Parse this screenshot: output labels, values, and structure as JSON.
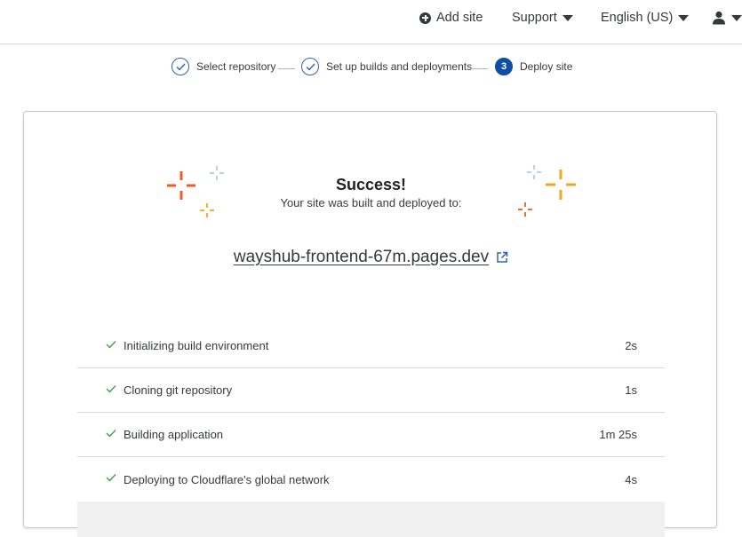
{
  "header": {
    "add_site": "Add site",
    "support": "Support",
    "language": "English (US)"
  },
  "stepper": {
    "steps": [
      {
        "label": "Select repository",
        "state": "complete"
      },
      {
        "label": "Set up builds and deployments",
        "state": "complete"
      },
      {
        "label": "Deploy site",
        "state": "active",
        "number": "3"
      }
    ]
  },
  "success": {
    "title": "Success!",
    "subtitle": "Your site was built and deployed to:",
    "site_url": "wayshub-frontend-67m.pages.dev"
  },
  "build_steps": [
    {
      "label": "Initializing build environment",
      "duration": "2s"
    },
    {
      "label": "Cloning git repository",
      "duration": "1s"
    },
    {
      "label": "Building application",
      "duration": "1m 25s"
    },
    {
      "label": "Deploying to Cloudflare's global network",
      "duration": "4s"
    }
  ],
  "colors": {
    "accent": "#0e4ea8",
    "success_check": "#3a9c4f",
    "spark_orange": "#f15a24",
    "spark_yellow": "#f6a51f",
    "spark_blue": "#9fc8ee"
  }
}
